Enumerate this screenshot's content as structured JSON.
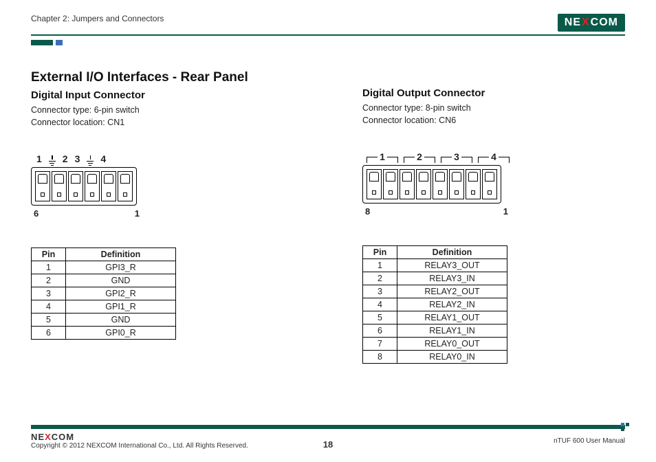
{
  "header": {
    "chapter": "Chapter 2: Jumpers and Connectors",
    "brand_pre": "NE",
    "brand_x": "X",
    "brand_post": "COM"
  },
  "page_title": "External I/O Interfaces - Rear Panel",
  "left": {
    "heading": "Digital Input Connector",
    "type_line": "Connector type: 6-pin switch",
    "loc_line": "Connector location: CN1",
    "top_labels": [
      "1",
      "2",
      "3",
      "4"
    ],
    "end_left": "6",
    "end_right": "1",
    "pin_count": 6,
    "table_head": [
      "Pin",
      "Definition"
    ],
    "rows": [
      [
        "1",
        "GPI3_R"
      ],
      [
        "2",
        "GND"
      ],
      [
        "3",
        "GPI2_R"
      ],
      [
        "4",
        "GPI1_R"
      ],
      [
        "5",
        "GND"
      ],
      [
        "6",
        "GPI0_R"
      ]
    ]
  },
  "right": {
    "heading": "Digital Output Connector",
    "type_line": "Connector type: 8-pin switch",
    "loc_line": "Connector location: CN6",
    "top_labels": [
      "1",
      "2",
      "3",
      "4"
    ],
    "end_left": "8",
    "end_right": "1",
    "pin_count": 8,
    "table_head": [
      "Pin",
      "Definition"
    ],
    "rows": [
      [
        "1",
        "RELAY3_OUT"
      ],
      [
        "2",
        "RELAY3_IN"
      ],
      [
        "3",
        "RELAY2_OUT"
      ],
      [
        "4",
        "RELAY2_IN"
      ],
      [
        "5",
        "RELAY1_OUT"
      ],
      [
        "6",
        "RELAY1_IN"
      ],
      [
        "7",
        "RELAY0_OUT"
      ],
      [
        "8",
        "RELAY0_IN"
      ]
    ]
  },
  "footer": {
    "copyright": "Copyright © 2012 NEXCOM International Co., Ltd. All Rights Reserved.",
    "page": "18",
    "manual": "nTUF 600 User Manual",
    "brand_pre": "NE",
    "brand_x": "X",
    "brand_post": "COM"
  }
}
